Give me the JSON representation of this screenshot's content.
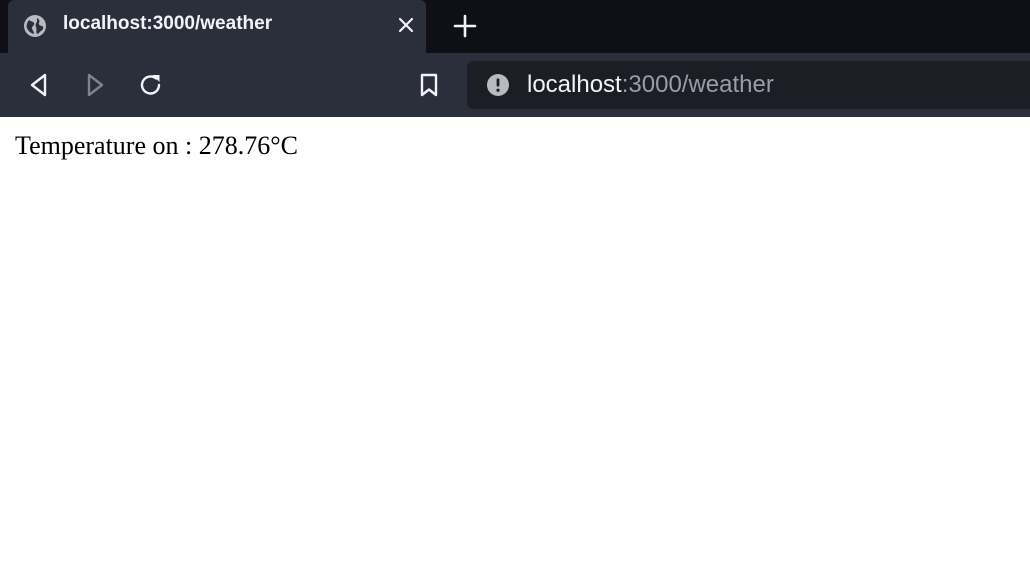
{
  "tab": {
    "title": "localhost:3000/weather",
    "favicon": "globe-icon",
    "close_icon": "close-icon"
  },
  "tabstrip": {
    "new_tab_icon": "plus-icon"
  },
  "toolbar": {
    "back_icon": "back-arrow-icon",
    "forward_icon": "forward-arrow-icon",
    "reload_icon": "reload-icon",
    "bookmark_icon": "bookmark-icon"
  },
  "urlbar": {
    "info_icon": "info-icon",
    "host": "localhost",
    "path": ":3000/weather"
  },
  "page": {
    "temperature_text": "Temperature on : 278.76°C"
  },
  "colors": {
    "tabstrip_bg": "#0f1016",
    "toolbar_bg": "#2b2e3b",
    "urlbar_bg": "#1c1e26",
    "text_light": "#f2f3f7",
    "text_muted": "#9a9ca6",
    "page_bg": "#ffffff"
  }
}
